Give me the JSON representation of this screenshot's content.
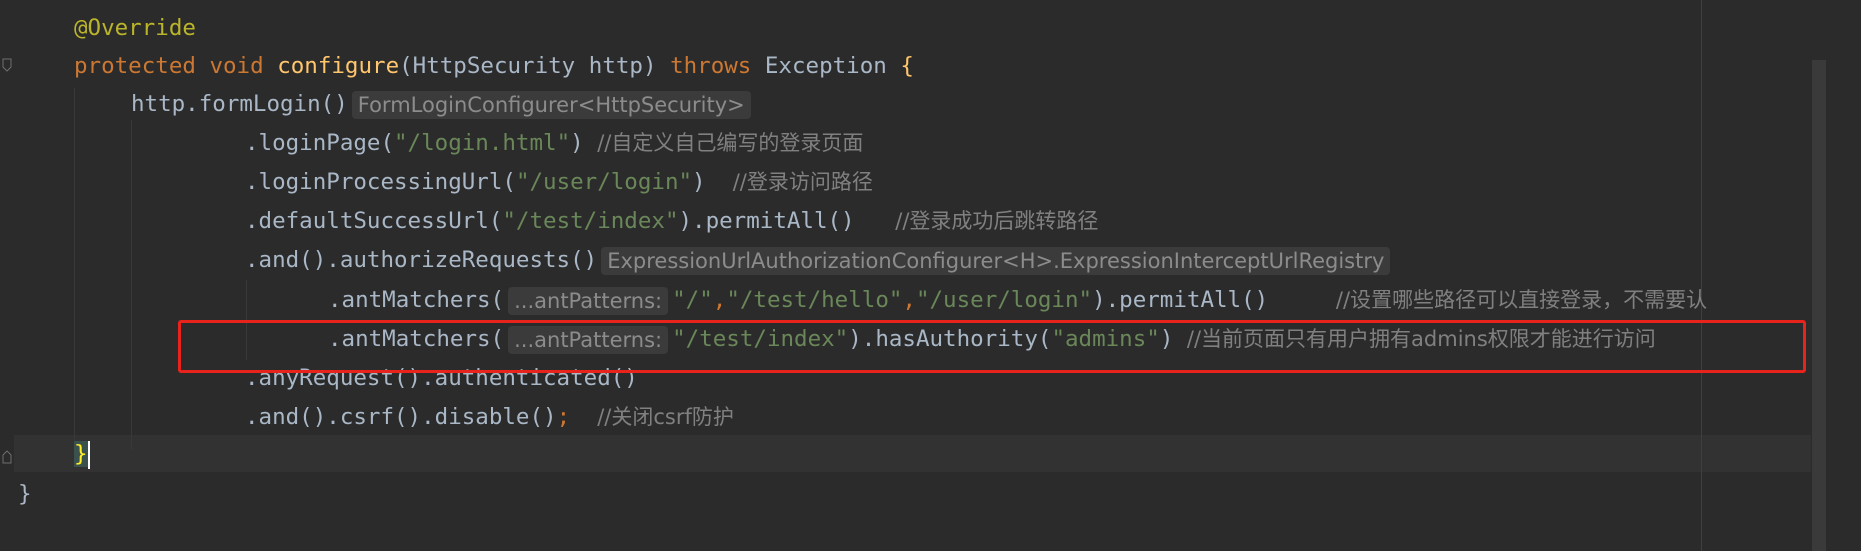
{
  "editor": {
    "lines": {
      "l1": {
        "annotation": "@Override"
      },
      "l2": {
        "kw_protected": "protected",
        "kw_void": "void",
        "method": "configure",
        "params": "(HttpSecurity http) ",
        "kw_throws": "throws",
        "exception": " Exception ",
        "brace": "{"
      },
      "l3": {
        "code": "http.formLogin()",
        "hint": "FormLoginConfigurer<HttpSecurity>"
      },
      "l4": {
        "pre": ".loginPage(",
        "str": "\"/login.html\"",
        "post": ") ",
        "comment": "//自定义自己编写的登录页面"
      },
      "l5": {
        "pre": ".loginProcessingUrl(",
        "str": "\"/user/login\"",
        "post": ")  ",
        "comment": "//登录访问路径"
      },
      "l6": {
        "pre": ".defaultSuccessUrl(",
        "str": "\"/test/index\"",
        "post": ").permitAll()   ",
        "comment": "//登录成功后跳转路径"
      },
      "l7": {
        "code": ".and().authorizeRequests()",
        "hint": "ExpressionUrlAuthorizationConfigurer<H>.ExpressionInterceptUrlRegistry"
      },
      "l8": {
        "pre": ".antMatchers(",
        "hint": "...antPatterns:",
        "s1": "\"/\"",
        "c1": ",",
        "s2": "\"/test/hello\"",
        "c2": ",",
        "s3": "\"/user/login\"",
        "post": ").permitAll()     ",
        "comment": "//设置哪些路径可以直接登录，不需要认"
      },
      "l9": {
        "pre": ".antMatchers(",
        "hint": "...antPatterns:",
        "s1": "\"/test/index\"",
        "mid": ").hasAuthority(",
        "s2": "\"admins\"",
        "post": ") ",
        "comment": "//当前页面只有用户拥有admins权限才能进行访问"
      },
      "l10": {
        "code": ".anyRequest().authenticated()"
      },
      "l11": {
        "code": ".and().csrf().disable()",
        "semi": ";",
        "comment": "//关闭csrf防护"
      },
      "l12": {
        "brace": "}"
      },
      "l13": {
        "brace": "}"
      }
    },
    "colors": {
      "background": "#2b2b2b",
      "keyword": "#cc7832",
      "annotation": "#bbb529",
      "method": "#ffc66d",
      "string": "#6a8759",
      "comment": "#808080",
      "highlight_box": "#e8231b"
    }
  }
}
